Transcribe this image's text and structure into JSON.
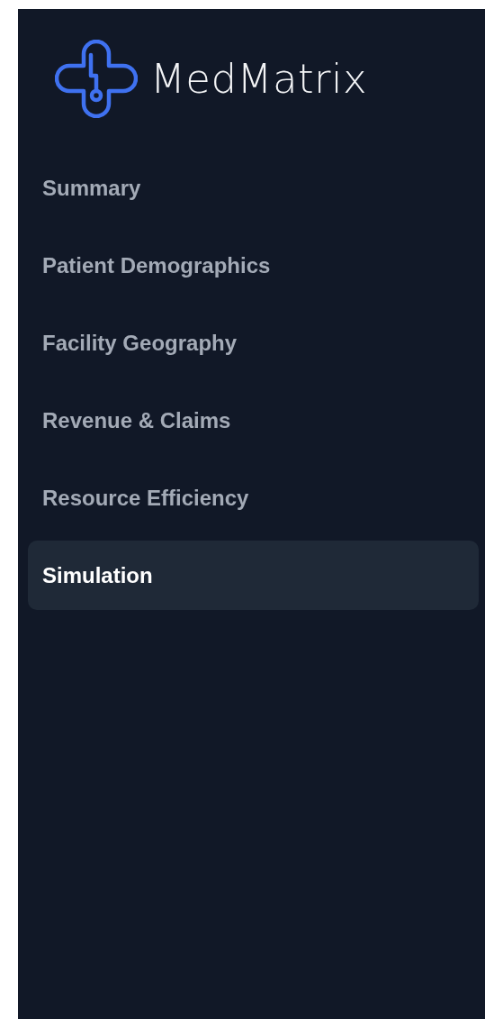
{
  "brand": {
    "name": "MedMatrix"
  },
  "nav": [
    {
      "label": "Summary",
      "selected": false
    },
    {
      "label": "Patient Demographics",
      "selected": false
    },
    {
      "label": "Facility Geography",
      "selected": false
    },
    {
      "label": "Revenue & Claims",
      "selected": false
    },
    {
      "label": "Resource Efficiency",
      "selected": false
    },
    {
      "label": "Simulation",
      "selected": true
    }
  ]
}
